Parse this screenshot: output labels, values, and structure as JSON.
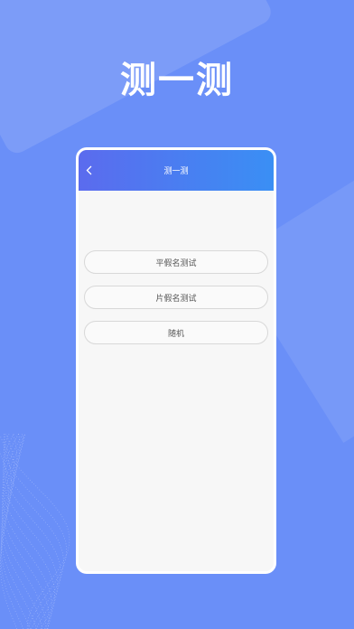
{
  "promo": {
    "title": "测一测"
  },
  "navbar": {
    "title": "测一测"
  },
  "options": [
    {
      "label": "平假名测试"
    },
    {
      "label": "片假名测试"
    },
    {
      "label": "随机"
    }
  ],
  "colors": {
    "background": "#6a8ff8",
    "navbar_start": "#5b6bee",
    "navbar_end": "#3a8ff4"
  }
}
